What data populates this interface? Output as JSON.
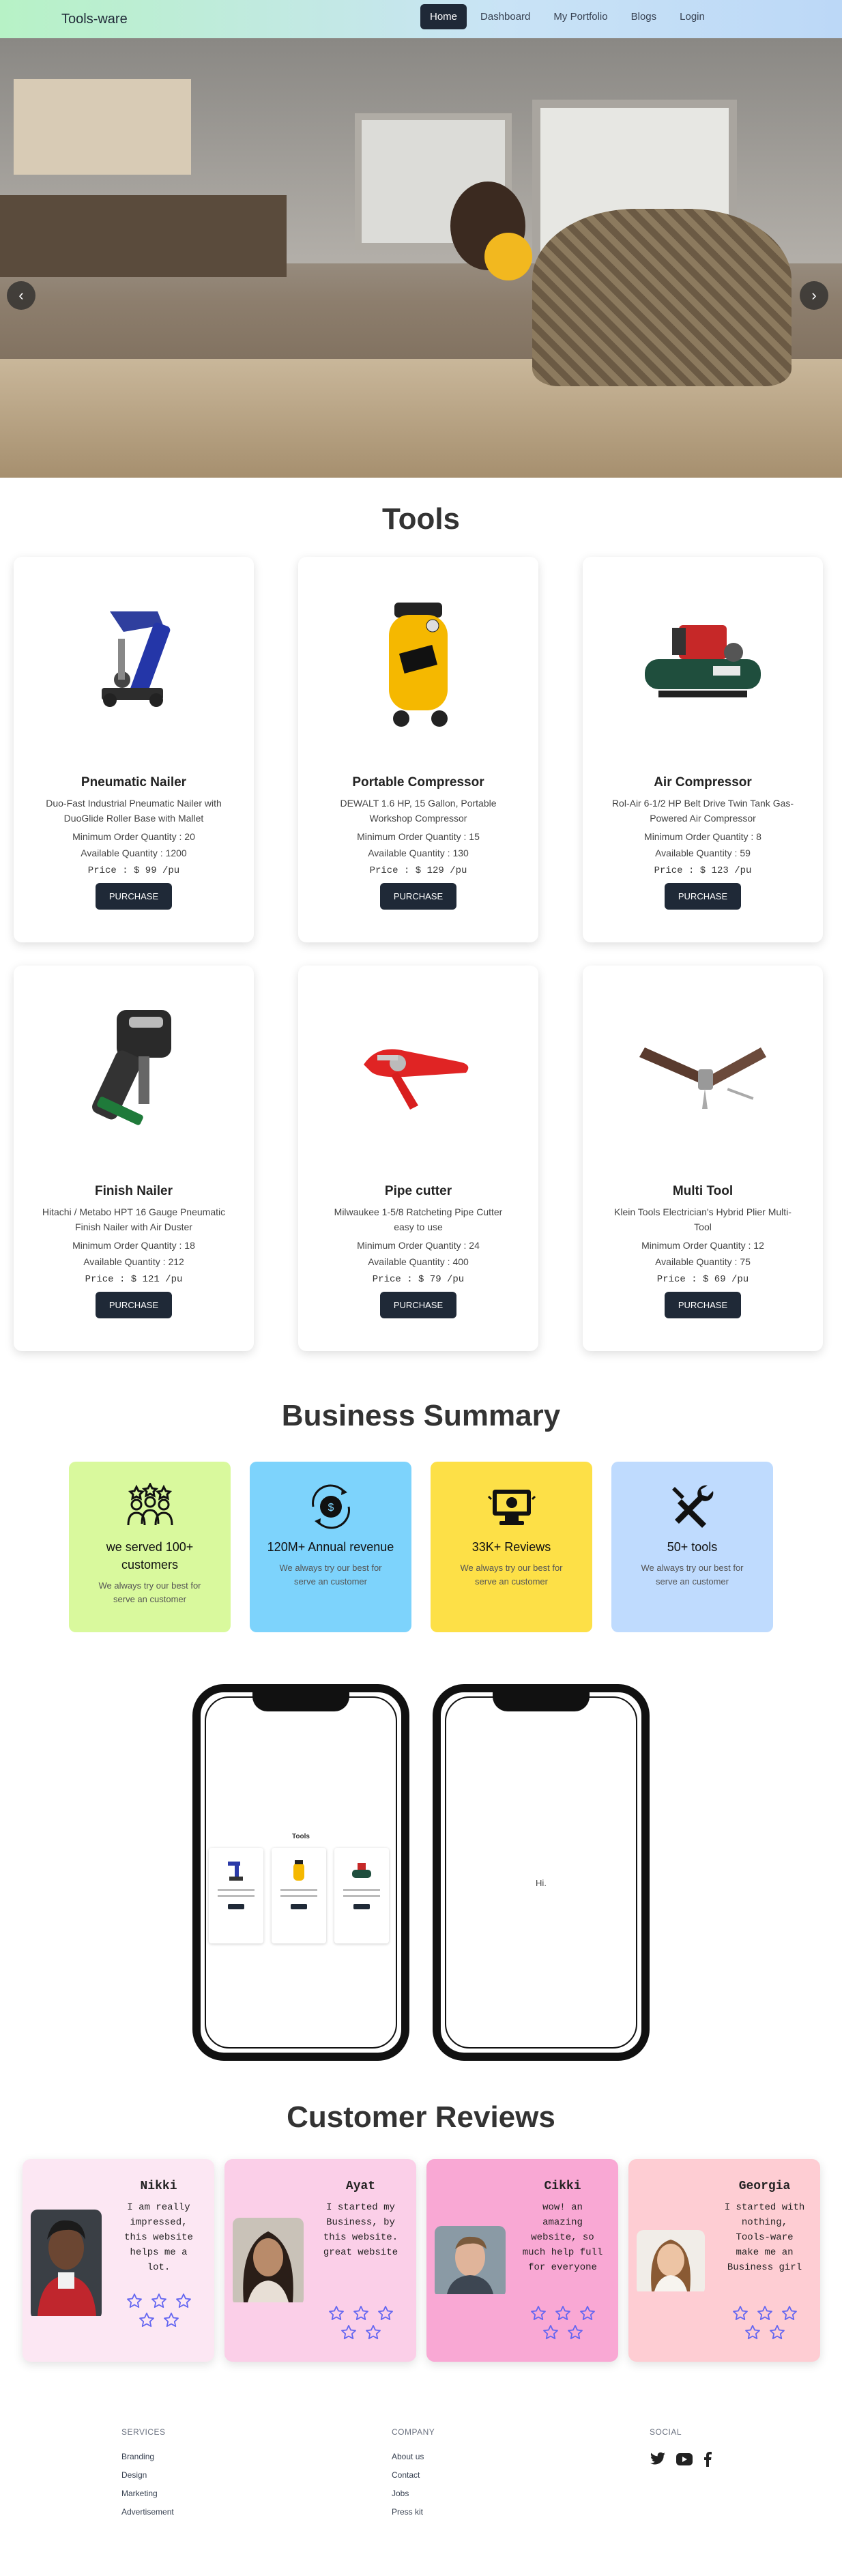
{
  "nav": {
    "brand": "Tools-ware",
    "links": [
      "Home",
      "Dashboard",
      "My Portfolio",
      "Blogs",
      "Login"
    ]
  },
  "hero": {
    "prev_icon": "chevron-left-icon",
    "next_icon": "chevron-right-icon",
    "prev_glyph": "‹",
    "next_glyph": "›"
  },
  "tools": {
    "title": "Tools",
    "purchase_label": "PURCHASE",
    "items": [
      {
        "name": "Pneumatic Nailer",
        "desc": "Duo-Fast Industrial Pneumatic Nailer with DuoGlide Roller Base with Mallet",
        "min": "Minimum Order Quantity : 20",
        "avail": "Available Quantity : 1200",
        "price": "Price : $ 99 /pu"
      },
      {
        "name": "Portable Compressor",
        "desc": "DEWALT 1.6 HP, 15 Gallon, Portable Workshop Compressor",
        "min": "Minimum Order Quantity : 15",
        "avail": "Available Quantity : 130",
        "price": "Price : $ 129 /pu"
      },
      {
        "name": "Air Compressor",
        "desc": "Rol-Air 6-1/2 HP Belt Drive Twin Tank Gas-Powered Air Compressor",
        "min": "Minimum Order Quantity : 8",
        "avail": "Available Quantity : 59",
        "price": "Price : $ 123 /pu"
      },
      {
        "name": "Finish Nailer",
        "desc": "Hitachi / Metabo HPT 16 Gauge Pneumatic Finish Nailer with Air Duster",
        "min": "Minimum Order Quantity : 18",
        "avail": "Available Quantity : 212",
        "price": "Price : $ 121 /pu"
      },
      {
        "name": "Pipe cutter",
        "desc": "Milwaukee 1-5/8 Ratcheting Pipe Cutter easy to use",
        "min": "Minimum Order Quantity : 24",
        "avail": "Available Quantity : 400",
        "price": "Price : $ 79 /pu"
      },
      {
        "name": "Multi Tool",
        "desc": "Klein Tools Electrician's Hybrid Plier Multi-Tool",
        "min": "Minimum Order Quantity : 12",
        "avail": "Available Quantity : 75",
        "price": "Price : $ 69 /pu"
      }
    ]
  },
  "business": {
    "title": "Business Summary",
    "cards": [
      {
        "head": "we served 100+ customers",
        "text": "We always try our best for serve an customer",
        "color": "#d9f99d",
        "icon": "people-stars-icon"
      },
      {
        "head": "120M+ Annual revenue",
        "text": "We always try our best for serve an customer",
        "color": "#7dd3fc",
        "icon": "revenue-icon"
      },
      {
        "head": "33K+ Reviews",
        "text": "We always try our best for serve an customer",
        "color": "#fde047",
        "icon": "review-monitor-icon"
      },
      {
        "head": "50+ tools",
        "text": "We always try our best for serve an customer",
        "color": "#bfdbfe",
        "icon": "tools-icon"
      }
    ]
  },
  "phones": {
    "mini_title": "Tools",
    "hi": "Hi."
  },
  "reviews": {
    "title": "Customer Reviews",
    "items": [
      {
        "name": "Nikki",
        "text": "I am really impressed, this website helps me a lot.",
        "color": "#fce7f3"
      },
      {
        "name": "Ayat",
        "text": "I started my Business, by this website. great website",
        "color": "#fbcfe8"
      },
      {
        "name": "Cikki",
        "text": "wow! an amazing website, so much help full for everyone",
        "color": "#f9a8d4"
      },
      {
        "name": "Georgia",
        "text": "I started with nothing, Tools-ware make me an Business girl",
        "color": "#fecdd3"
      }
    ]
  },
  "footer": {
    "services": {
      "head": "SERVICES",
      "links": [
        "Branding",
        "Design",
        "Marketing",
        "Advertisement"
      ]
    },
    "company": {
      "head": "COMPANY",
      "links": [
        "About us",
        "Contact",
        "Jobs",
        "Press kit"
      ]
    },
    "social": {
      "head": "SOCIAL",
      "icons": [
        "twitter-icon",
        "youtube-icon",
        "facebook-icon"
      ]
    }
  }
}
